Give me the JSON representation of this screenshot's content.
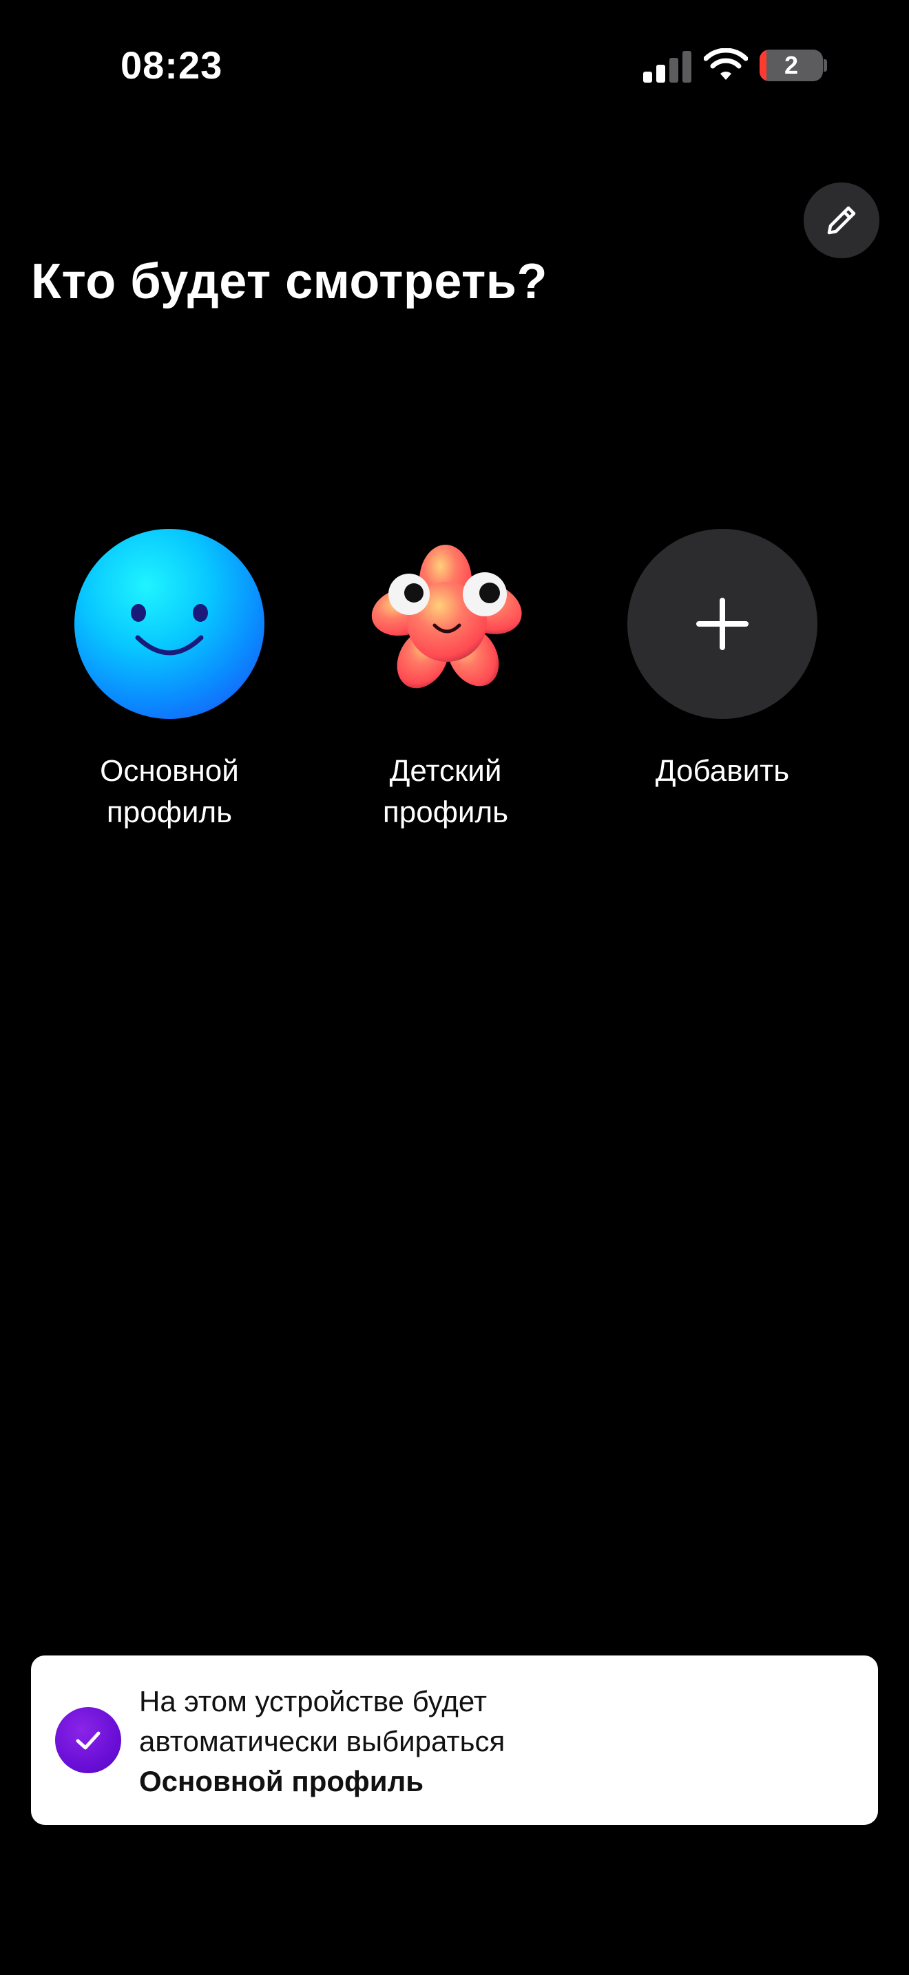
{
  "status_bar": {
    "time": "08:23",
    "battery_level": "2",
    "battery_color": "#ff3b30"
  },
  "edit": {
    "icon": "pencil-icon"
  },
  "title": "Кто будет смотреть?",
  "profiles": [
    {
      "line1": "Основной",
      "line2": "профиль",
      "avatar": "smiley-blue-avatar"
    },
    {
      "line1": "Детский",
      "line2": "профиль",
      "avatar": "kids-flower-avatar"
    },
    {
      "line1": "Добавить",
      "line2": "",
      "avatar": "plus-icon"
    }
  ],
  "toast": {
    "line1": "На этом устройстве будет",
    "line2": "автоматически выбираться",
    "line3": "Основной профиль",
    "icon": "check-icon",
    "accent": "#6a0fd6"
  }
}
